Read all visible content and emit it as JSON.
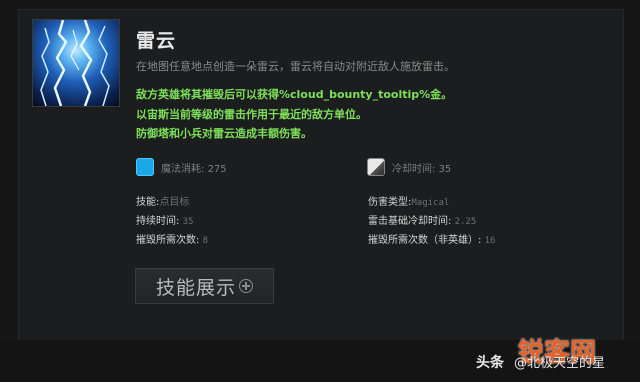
{
  "ability": {
    "name": "雷云",
    "description": "在地图任意地点创造一朵雷云，雷云将自动对附近敌人施放雷击。",
    "notes": [
      "敌方英雄将其摧毁后可以获得%cloud_bounty_tooltip%金。",
      "以宙斯当前等级的雷击作用于最近的敌方单位。",
      "防御塔和小兵对雷云造成丰额伤害。"
    ],
    "icon": "lightning-cloud-icon"
  },
  "costs": {
    "mana_label": "魔法消耗:",
    "mana_value": "275",
    "cooldown_label": "冷却时间:",
    "cooldown_value": "35"
  },
  "details": {
    "left": [
      {
        "key": "技能:",
        "value": "点目标"
      },
      {
        "key": "持续时间:",
        "value": "35"
      },
      {
        "key": "摧毁所需次数:",
        "value": "8"
      }
    ],
    "right": [
      {
        "key": "伤害类型:",
        "value": "Magical"
      },
      {
        "key": "雷击基础冷却时间:",
        "value": "2.25"
      },
      {
        "key": "摧毁所需次数（非英雄）:",
        "value": "16"
      }
    ]
  },
  "demo_button": {
    "label": "技能展示"
  },
  "watermark": {
    "source": "头条",
    "handle": "@北极天空的星",
    "logo": "锐客网"
  },
  "colors": {
    "accent_green": "#7ee05a",
    "mana_blue": "#1aa8e8",
    "background": "#1c1d1e"
  }
}
